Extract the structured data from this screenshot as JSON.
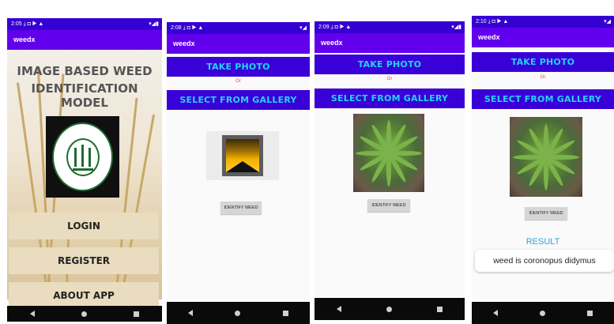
{
  "phones": [
    {
      "time": "2:05",
      "app_title": "weedx"
    },
    {
      "time": "2:08",
      "app_title": "weedx"
    },
    {
      "time": "2:09",
      "app_title": "weedx"
    },
    {
      "time": "2:10",
      "app_title": "weedx"
    }
  ],
  "home": {
    "title_line1": "IMAGE BASED WEED",
    "title_line2": "IDENTIFICATION MODEL",
    "login": "LOGIN",
    "register": "REGISTER",
    "about": "ABOUT APP"
  },
  "capture": {
    "take_photo": "TAKE PHOTO",
    "or": "Or",
    "select_gallery": "SELECT FROM GALLERY",
    "identify": "IDENTIFY WEED"
  },
  "result": {
    "title": "RESULT",
    "text": "weed  is coronopus didymus"
  },
  "colors": {
    "status_bar": "#3500d3",
    "app_bar": "#6200ee",
    "action_button": "#3a00d8",
    "action_text": "#23d3f3",
    "or_text": "#e0533a",
    "result_title": "#2aa6d6"
  },
  "icons": {
    "status_left": [
      "download-icon",
      "shield-icon",
      "play-icon",
      "warning-icon"
    ],
    "status_right": [
      "wifi-icon",
      "signal-icon",
      "battery-icon"
    ],
    "nav": [
      "back-icon",
      "home-icon",
      "recents-icon"
    ]
  }
}
